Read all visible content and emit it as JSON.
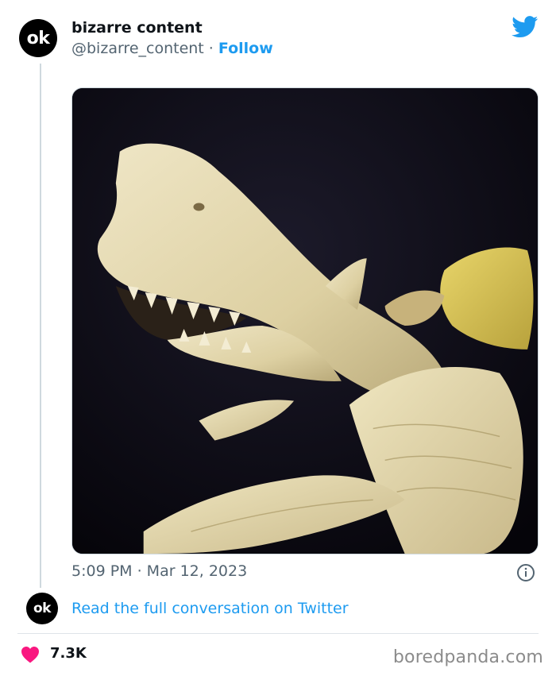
{
  "tweet": {
    "avatar_text": "ok",
    "author_name": "bizarre content",
    "handle": "@bizarre_content",
    "separator": " · ",
    "follow_label": "Follow",
    "timestamp": "5:09 PM · Mar 12, 2023",
    "read_more": "Read the full conversation on Twitter",
    "likes": "7.3K"
  },
  "media": {
    "description": "banana carved into a shark"
  },
  "footer": {
    "watermark": "boredpanda.com"
  },
  "icons": {
    "brand": "twitter-bird-icon",
    "info": "info-icon",
    "like": "heart-icon"
  },
  "colors": {
    "accent": "#1d9bf0",
    "text": "#0f1419",
    "muted": "#536471",
    "heart": "#f91880"
  }
}
